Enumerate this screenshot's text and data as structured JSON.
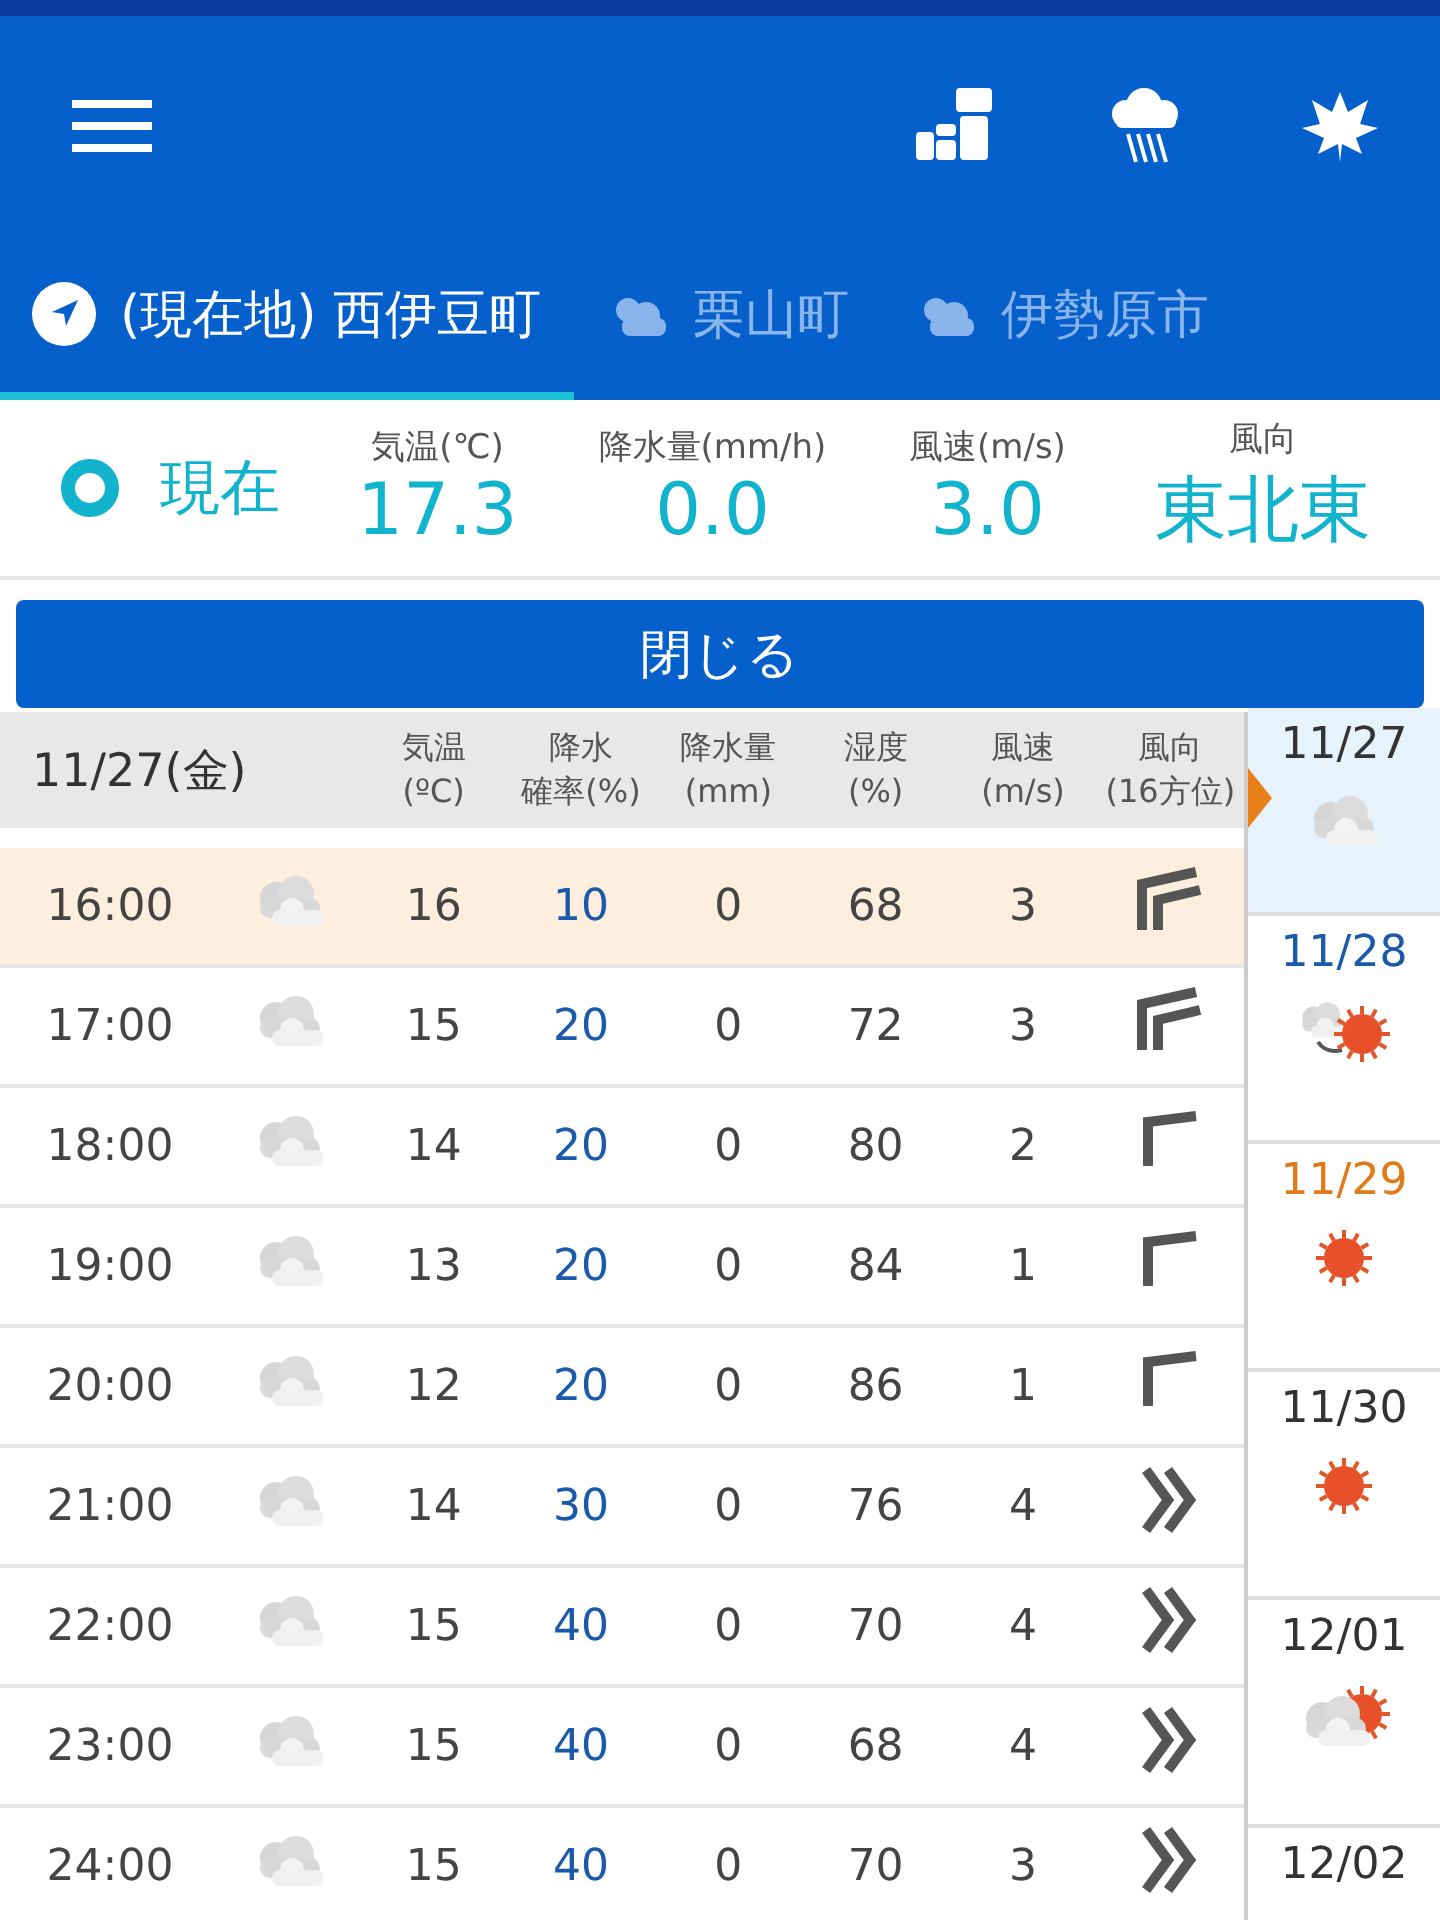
{
  "tabs": [
    {
      "label": "(現在地) 西伊豆町",
      "kind": "location",
      "selected": true
    },
    {
      "label": "栗山町",
      "kind": "partly-cloudy",
      "selected": false
    },
    {
      "label": "伊勢原市",
      "kind": "partly-cloudy",
      "selected": false
    }
  ],
  "current": {
    "label": "現在",
    "readings": [
      {
        "label": "気温(℃)",
        "value": "17.3"
      },
      {
        "label": "降水量(mm/h)",
        "value": "0.0"
      },
      {
        "label": "風速(m/s)",
        "value": "3.0"
      },
      {
        "label": "風向",
        "value": "東北東"
      }
    ]
  },
  "close_button": "閉じる",
  "table": {
    "date": "11/27",
    "weekday": "(金)",
    "columns": [
      [
        "気温",
        "(ºC)"
      ],
      [
        "降水",
        "確率(%)"
      ],
      [
        "降水量",
        "(mm)"
      ],
      [
        "湿度",
        "(%)"
      ],
      [
        "風速",
        "(m/s)"
      ],
      [
        "風向",
        "(16方位)"
      ]
    ],
    "rows": [
      {
        "time": "16:00",
        "temp": "16",
        "pop": "10",
        "rain": "0",
        "humidity": "68",
        "wind": "3",
        "kind": "double-corner",
        "current": true
      },
      {
        "time": "17:00",
        "temp": "15",
        "pop": "20",
        "rain": "0",
        "humidity": "72",
        "wind": "3",
        "kind": "double-corner",
        "current": false
      },
      {
        "time": "18:00",
        "temp": "14",
        "pop": "20",
        "rain": "0",
        "humidity": "80",
        "wind": "2",
        "kind": "corner",
        "current": false
      },
      {
        "time": "19:00",
        "temp": "13",
        "pop": "20",
        "rain": "0",
        "humidity": "84",
        "wind": "1",
        "kind": "corner",
        "current": false
      },
      {
        "time": "20:00",
        "temp": "12",
        "pop": "20",
        "rain": "0",
        "humidity": "86",
        "wind": "1",
        "kind": "corner",
        "current": false
      },
      {
        "time": "21:00",
        "temp": "14",
        "pop": "30",
        "rain": "0",
        "humidity": "76",
        "wind": "4",
        "kind": "double-chevron",
        "current": false
      },
      {
        "time": "22:00",
        "temp": "15",
        "pop": "40",
        "rain": "0",
        "humidity": "70",
        "wind": "4",
        "kind": "double-chevron",
        "current": false
      },
      {
        "time": "23:00",
        "temp": "15",
        "pop": "40",
        "rain": "0",
        "humidity": "68",
        "wind": "4",
        "kind": "double-chevron",
        "current": false
      },
      {
        "time": "24:00",
        "temp": "15",
        "pop": "40",
        "rain": "0",
        "humidity": "70",
        "wind": "3",
        "kind": "double-chevron",
        "current": false
      }
    ]
  },
  "days": [
    {
      "date": "11/27",
      "kind": "cloudy",
      "color": "#333333",
      "selected": true
    },
    {
      "date": "11/28",
      "kind": "cloudy-then-sunny",
      "color": "#1a5aa8",
      "selected": false
    },
    {
      "date": "11/29",
      "kind": "sunny",
      "color": "#e07a1a",
      "selected": false
    },
    {
      "date": "11/30",
      "kind": "sunny",
      "color": "#333333",
      "selected": false
    },
    {
      "date": "12/01",
      "kind": "cloudy-sunny",
      "color": "#333333",
      "selected": false
    },
    {
      "date": "12/02",
      "kind": "none",
      "color": "#333333",
      "selected": false
    }
  ]
}
